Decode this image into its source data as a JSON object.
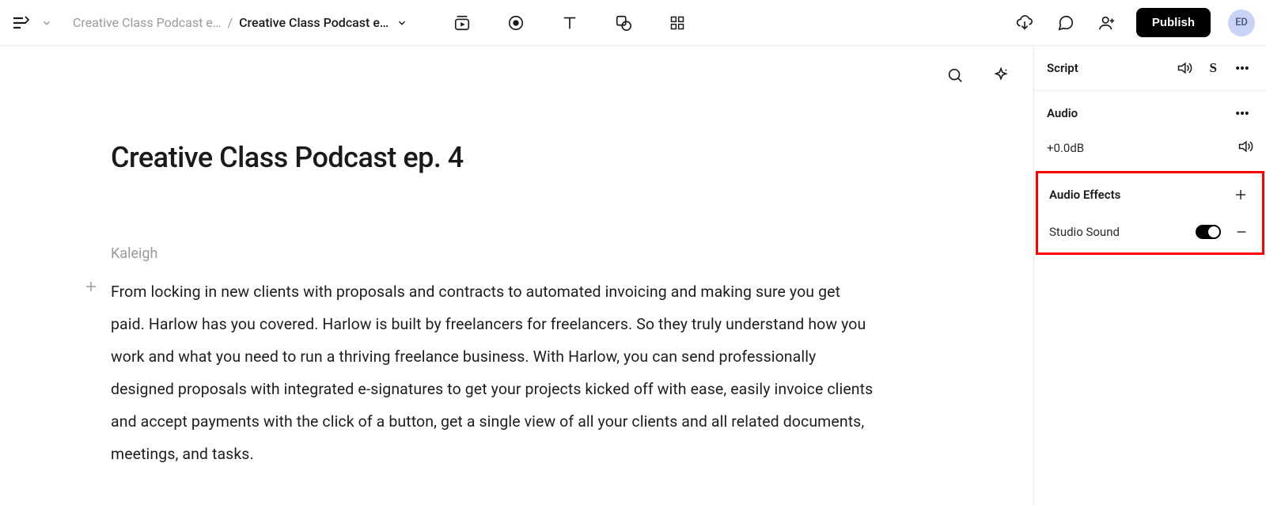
{
  "breadcrumb": {
    "parent": "Creative Class Podcast e…",
    "current": "Creative Class Podcast e…",
    "separator": "/"
  },
  "topbar": {
    "publish_label": "Publish",
    "avatar_initials": "ED"
  },
  "document": {
    "title": "Creative Class Podcast ep. 4",
    "speaker": "Kaleigh",
    "paragraph": "From locking in new clients with proposals and contracts to automated invoicing and making sure you get paid. Harlow has you covered. Harlow is built by freelancers for freelancers. So they truly understand how you work and what you need to run a thriving freelance business. With Harlow, you can send professionally designed proposals with integrated e-signatures to get your projects kicked off with ease, easily invoice clients and accept payments with the click of a button, get a single view of all your clients and all related documents, meetings, and tasks."
  },
  "side_panel": {
    "script_label": "Script",
    "audio_label": "Audio",
    "gain_value": "+0.0dB",
    "effects_label": "Audio Effects",
    "effect_name": "Studio Sound"
  }
}
